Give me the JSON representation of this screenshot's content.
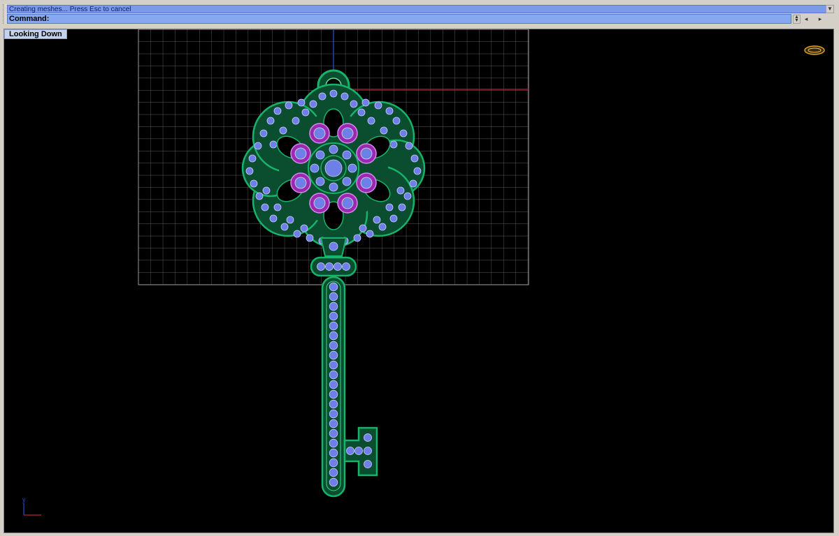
{
  "command_history": {
    "last_message": "Creating meshes... Press Esc to cancel"
  },
  "command_line": {
    "prompt": "Command:",
    "value": ""
  },
  "viewport": {
    "title": "Looking Down",
    "axis_label_y": "y"
  },
  "icons": {
    "history_scroll": "scroll-down-icon",
    "spin": "spin-updown-icon",
    "left_arrow": "arrow-left-icon",
    "right_arrow": "arrow-right-icon",
    "nav_widget": "viewport-navigator-icon"
  },
  "colors": {
    "viewport_bg": "#000000",
    "grid": "#7a7a7a",
    "model_outline": "#18b36a",
    "gem_fill": "#6f7fe8",
    "large_gem": "#9a28b0",
    "axis_x": "#c02030",
    "axis_y": "#2a4adc"
  }
}
